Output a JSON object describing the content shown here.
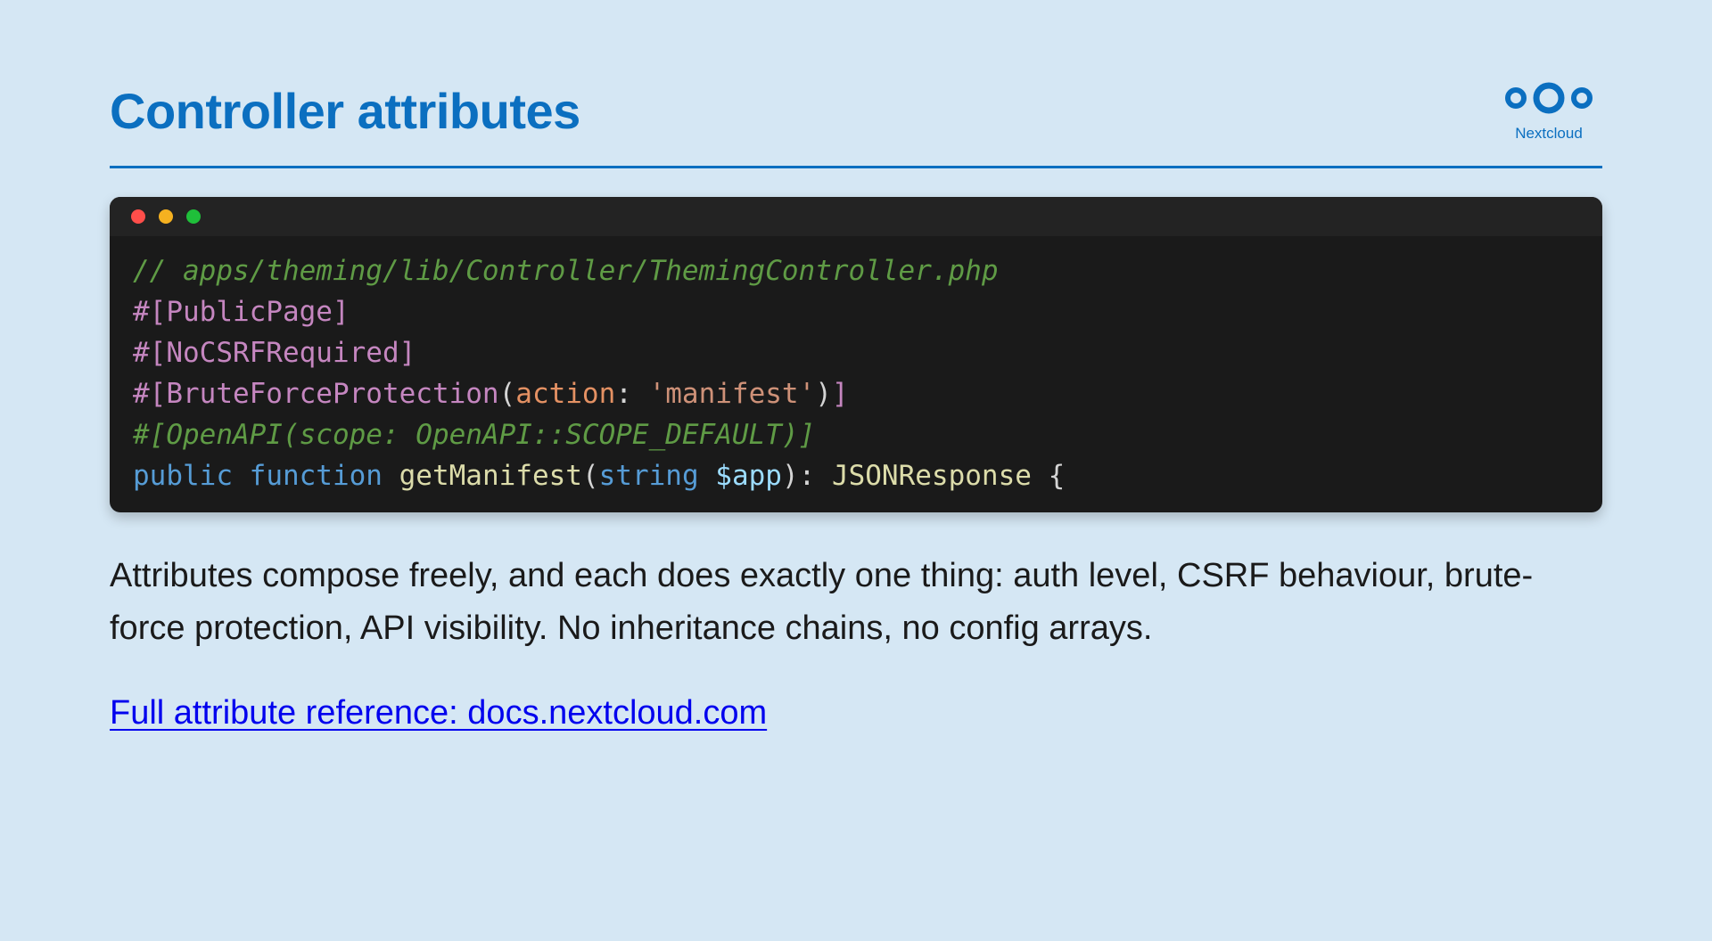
{
  "slide": {
    "title": "Controller attributes",
    "logo_text": "Nextcloud",
    "description": "Attributes compose freely, and each does exactly one thing: auth level, CSRF behaviour, brute-force protection, API visibility. No inheritance chains, no config arrays.",
    "link_text": "Full attribute reference: docs.nextcloud.com"
  },
  "code": {
    "line1": {
      "comment": "// apps/theming/lib/Controller/ThemingController.php"
    },
    "line2": {
      "attribute": "#[PublicPage]"
    },
    "line3": {
      "attribute": "#[NoCSRFRequired]"
    },
    "line4": {
      "attr_open": "#[BruteForceProtection",
      "paren_open": "(",
      "param_name": "action",
      "colon": ": ",
      "string_value": "'manifest'",
      "paren_close": ")",
      "attr_close": "]"
    },
    "line5": {
      "comment": "#[OpenAPI(scope: OpenAPI::SCOPE_DEFAULT)]"
    },
    "line6": {
      "kw_public": "public",
      "kw_function": "function",
      "fn_name": "getManifest",
      "paren_open": "(",
      "type": "string",
      "var": "$app",
      "paren_close": "): ",
      "return_type": "JSONResponse",
      "brace": " {"
    }
  },
  "colors": {
    "background": "#d5e7f4",
    "accent": "#0b6fc0",
    "code_background": "#1a1a1a",
    "link": "#0000ee",
    "dot_red": "#ff4e4a",
    "dot_yellow": "#f5b120",
    "dot_green": "#1fbf3a"
  },
  "icons": {
    "logo": "nextcloud-logo-icon",
    "window_controls": [
      "close-dot-icon",
      "minimize-dot-icon",
      "maximize-dot-icon"
    ]
  }
}
